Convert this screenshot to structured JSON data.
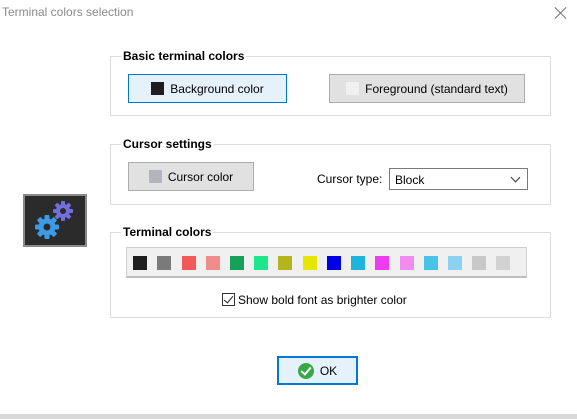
{
  "window": {
    "title": "Terminal colors selection"
  },
  "basic": {
    "legend": "Basic terminal colors",
    "background_label": "Background color",
    "background_swatch": "#1e1e1e",
    "foreground_label": "Foreground (standard text)",
    "foreground_swatch": "#f0f0f0"
  },
  "cursor": {
    "legend": "Cursor settings",
    "color_label": "Cursor color",
    "color_swatch": "#b4b4bc",
    "type_label": "Cursor type:",
    "type_value": "Block"
  },
  "terminal": {
    "legend": "Terminal colors",
    "palette": [
      "#1e1e1e",
      "#7a7a7a",
      "#f25a5a",
      "#f08c8c",
      "#16a05a",
      "#1ee68c",
      "#b4b41e",
      "#e6e600",
      "#0000e6",
      "#1eb4dc",
      "#f03cf0",
      "#f08cf0",
      "#46c3e6",
      "#8cd2f0",
      "#c8c8c8",
      "#d2d2d2"
    ],
    "bold_label": "Show bold font as brighter color",
    "bold_checked": true
  },
  "icon": {
    "name": "gears-icon",
    "panel_bg": "#2b2b2b",
    "gear_large": "#3c9be6",
    "gear_small": "#7070dc"
  },
  "ok": {
    "label": "OK"
  }
}
